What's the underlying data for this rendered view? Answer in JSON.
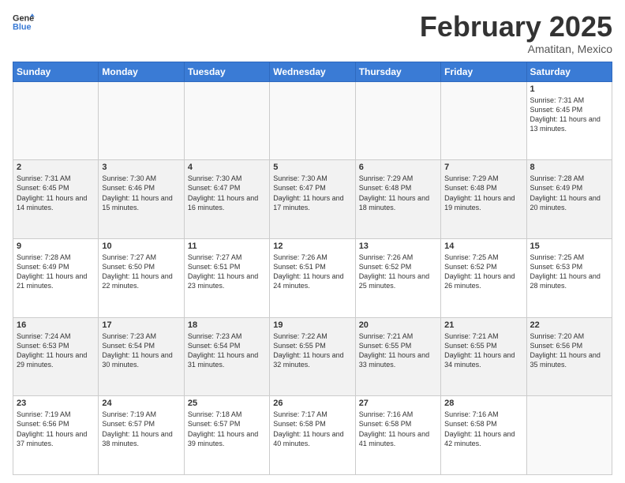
{
  "logo": {
    "line1": "General",
    "line2": "Blue"
  },
  "title": "February 2025",
  "subtitle": "Amatitan, Mexico",
  "days_of_week": [
    "Sunday",
    "Monday",
    "Tuesday",
    "Wednesday",
    "Thursday",
    "Friday",
    "Saturday"
  ],
  "weeks": [
    {
      "shaded": false,
      "days": [
        {
          "num": "",
          "info": ""
        },
        {
          "num": "",
          "info": ""
        },
        {
          "num": "",
          "info": ""
        },
        {
          "num": "",
          "info": ""
        },
        {
          "num": "",
          "info": ""
        },
        {
          "num": "",
          "info": ""
        },
        {
          "num": "1",
          "info": "Sunrise: 7:31 AM\nSunset: 6:45 PM\nDaylight: 11 hours and 13 minutes."
        }
      ]
    },
    {
      "shaded": true,
      "days": [
        {
          "num": "2",
          "info": "Sunrise: 7:31 AM\nSunset: 6:45 PM\nDaylight: 11 hours and 14 minutes."
        },
        {
          "num": "3",
          "info": "Sunrise: 7:30 AM\nSunset: 6:46 PM\nDaylight: 11 hours and 15 minutes."
        },
        {
          "num": "4",
          "info": "Sunrise: 7:30 AM\nSunset: 6:47 PM\nDaylight: 11 hours and 16 minutes."
        },
        {
          "num": "5",
          "info": "Sunrise: 7:30 AM\nSunset: 6:47 PM\nDaylight: 11 hours and 17 minutes."
        },
        {
          "num": "6",
          "info": "Sunrise: 7:29 AM\nSunset: 6:48 PM\nDaylight: 11 hours and 18 minutes."
        },
        {
          "num": "7",
          "info": "Sunrise: 7:29 AM\nSunset: 6:48 PM\nDaylight: 11 hours and 19 minutes."
        },
        {
          "num": "8",
          "info": "Sunrise: 7:28 AM\nSunset: 6:49 PM\nDaylight: 11 hours and 20 minutes."
        }
      ]
    },
    {
      "shaded": false,
      "days": [
        {
          "num": "9",
          "info": "Sunrise: 7:28 AM\nSunset: 6:49 PM\nDaylight: 11 hours and 21 minutes."
        },
        {
          "num": "10",
          "info": "Sunrise: 7:27 AM\nSunset: 6:50 PM\nDaylight: 11 hours and 22 minutes."
        },
        {
          "num": "11",
          "info": "Sunrise: 7:27 AM\nSunset: 6:51 PM\nDaylight: 11 hours and 23 minutes."
        },
        {
          "num": "12",
          "info": "Sunrise: 7:26 AM\nSunset: 6:51 PM\nDaylight: 11 hours and 24 minutes."
        },
        {
          "num": "13",
          "info": "Sunrise: 7:26 AM\nSunset: 6:52 PM\nDaylight: 11 hours and 25 minutes."
        },
        {
          "num": "14",
          "info": "Sunrise: 7:25 AM\nSunset: 6:52 PM\nDaylight: 11 hours and 26 minutes."
        },
        {
          "num": "15",
          "info": "Sunrise: 7:25 AM\nSunset: 6:53 PM\nDaylight: 11 hours and 28 minutes."
        }
      ]
    },
    {
      "shaded": true,
      "days": [
        {
          "num": "16",
          "info": "Sunrise: 7:24 AM\nSunset: 6:53 PM\nDaylight: 11 hours and 29 minutes."
        },
        {
          "num": "17",
          "info": "Sunrise: 7:23 AM\nSunset: 6:54 PM\nDaylight: 11 hours and 30 minutes."
        },
        {
          "num": "18",
          "info": "Sunrise: 7:23 AM\nSunset: 6:54 PM\nDaylight: 11 hours and 31 minutes."
        },
        {
          "num": "19",
          "info": "Sunrise: 7:22 AM\nSunset: 6:55 PM\nDaylight: 11 hours and 32 minutes."
        },
        {
          "num": "20",
          "info": "Sunrise: 7:21 AM\nSunset: 6:55 PM\nDaylight: 11 hours and 33 minutes."
        },
        {
          "num": "21",
          "info": "Sunrise: 7:21 AM\nSunset: 6:55 PM\nDaylight: 11 hours and 34 minutes."
        },
        {
          "num": "22",
          "info": "Sunrise: 7:20 AM\nSunset: 6:56 PM\nDaylight: 11 hours and 35 minutes."
        }
      ]
    },
    {
      "shaded": false,
      "days": [
        {
          "num": "23",
          "info": "Sunrise: 7:19 AM\nSunset: 6:56 PM\nDaylight: 11 hours and 37 minutes."
        },
        {
          "num": "24",
          "info": "Sunrise: 7:19 AM\nSunset: 6:57 PM\nDaylight: 11 hours and 38 minutes."
        },
        {
          "num": "25",
          "info": "Sunrise: 7:18 AM\nSunset: 6:57 PM\nDaylight: 11 hours and 39 minutes."
        },
        {
          "num": "26",
          "info": "Sunrise: 7:17 AM\nSunset: 6:58 PM\nDaylight: 11 hours and 40 minutes."
        },
        {
          "num": "27",
          "info": "Sunrise: 7:16 AM\nSunset: 6:58 PM\nDaylight: 11 hours and 41 minutes."
        },
        {
          "num": "28",
          "info": "Sunrise: 7:16 AM\nSunset: 6:58 PM\nDaylight: 11 hours and 42 minutes."
        },
        {
          "num": "",
          "info": ""
        }
      ]
    }
  ]
}
